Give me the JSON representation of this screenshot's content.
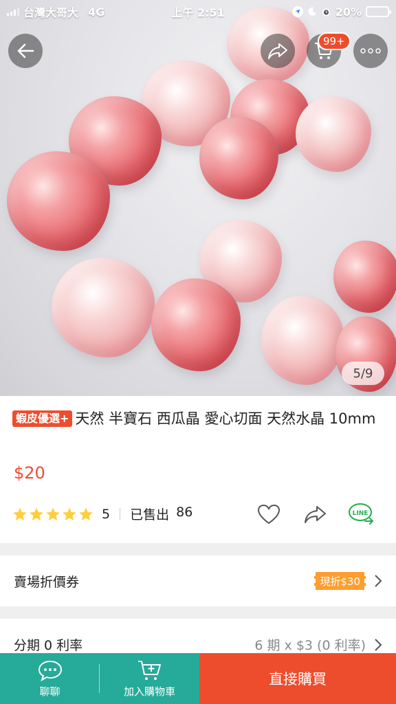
{
  "status_bar": {
    "carrier": "台灣大哥大",
    "network": "4G",
    "time": "上午 2:51",
    "battery": "20%",
    "battery_level": 0.2
  },
  "header": {
    "cart_badge": "99+",
    "image_position": "5/9"
  },
  "product": {
    "badge": "蝦皮優選+",
    "title": "天然 半寶石 西瓜晶 愛心切面 天然水晶 10mm",
    "price": "$20",
    "rating": "5",
    "stars": 5,
    "sold_label": "已售出",
    "sold_count": "86"
  },
  "rows": {
    "voucher_label": "賣場折價券",
    "voucher_tag": "現折$30",
    "installment_label": "分期 0 利率",
    "installment_value": "6 期 x $3 (0 利率)"
  },
  "bottom_bar": {
    "chat_label": "聊聊",
    "add_cart_label": "加入購物車",
    "buy_label": "直接購買"
  },
  "colors": {
    "brand": "#ee4d2d",
    "green": "#26aa99",
    "star": "#ffce3d",
    "voucher": "#ff9d2f"
  }
}
